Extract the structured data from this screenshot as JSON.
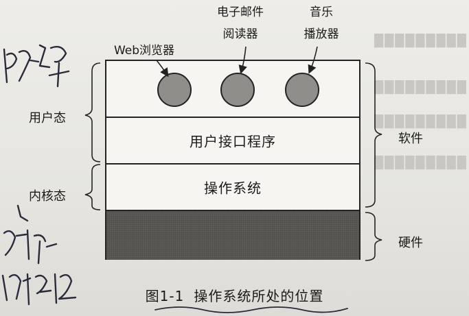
{
  "apps": [
    {
      "label_lines": [
        "Web浏览器"
      ]
    },
    {
      "label_lines": [
        "电子邮件",
        "阅读器"
      ]
    },
    {
      "label_lines": [
        "音乐",
        "播放器"
      ]
    }
  ],
  "layers": {
    "user_interface": "用户接口程序",
    "operating_system": "操作系统"
  },
  "side_labels": {
    "user_mode": "用户态",
    "kernel_mode": "内核态",
    "software": "软件",
    "hardware": "硬件"
  },
  "caption": {
    "number": "图1-1",
    "title": "操作系统所处的位置"
  },
  "colors": {
    "hardware_fill": "#5b5a57",
    "app_circle_fill": "#8f8e8a"
  }
}
